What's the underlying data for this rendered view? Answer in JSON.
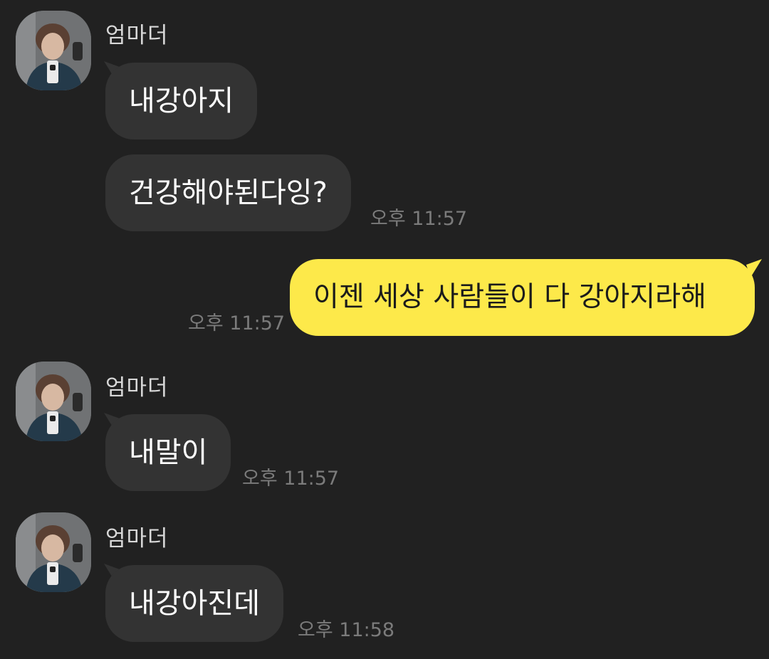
{
  "messages": [
    {
      "sender": "엄마더",
      "text": "내강아지"
    },
    {
      "text": "건강해야된다잉?",
      "time": "오후 11:57"
    },
    {
      "text": "이젠 세상 사람들이 다 강아지라해",
      "time": "오후 11:57"
    },
    {
      "sender": "엄마더",
      "text": "내말이",
      "time": "오후 11:57"
    },
    {
      "sender": "엄마더",
      "text": "내강아진데",
      "time": "오후 11:58"
    }
  ],
  "colors": {
    "background": "#212121",
    "incoming_bubble": "#333333",
    "outgoing_bubble": "#fde94a",
    "timestamp": "#7b7b7b"
  },
  "icons": {
    "avatar": "profile-photo"
  }
}
